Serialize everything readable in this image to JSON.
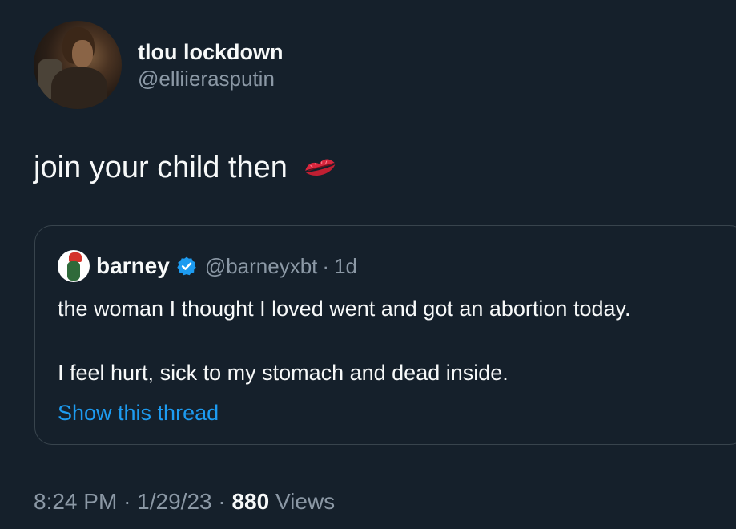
{
  "author": {
    "display_name": "tlou lockdown",
    "handle": "@elliierasputin"
  },
  "tweet": {
    "text": "join your child then",
    "emoji_icon": "kiss-mark-icon"
  },
  "quoted_tweet": {
    "display_name": "barney",
    "verified": true,
    "handle": "@barneyxbt",
    "separator": "·",
    "time": "1d",
    "line1": "the woman I thought I loved went and got an abortion today.",
    "line2": "I feel hurt, sick to my stomach and dead inside.",
    "show_thread": "Show this thread"
  },
  "meta": {
    "time": "8:24 PM",
    "sep1": "·",
    "date": "1/29/23",
    "sep2": "·",
    "views_count": "880",
    "views_label": "Views"
  },
  "colors": {
    "background": "#15202b",
    "text_primary": "#f7f9f9",
    "text_secondary": "#8b98a5",
    "link": "#1d9bf0",
    "border": "#38444d",
    "verified": "#1d9bf0"
  }
}
